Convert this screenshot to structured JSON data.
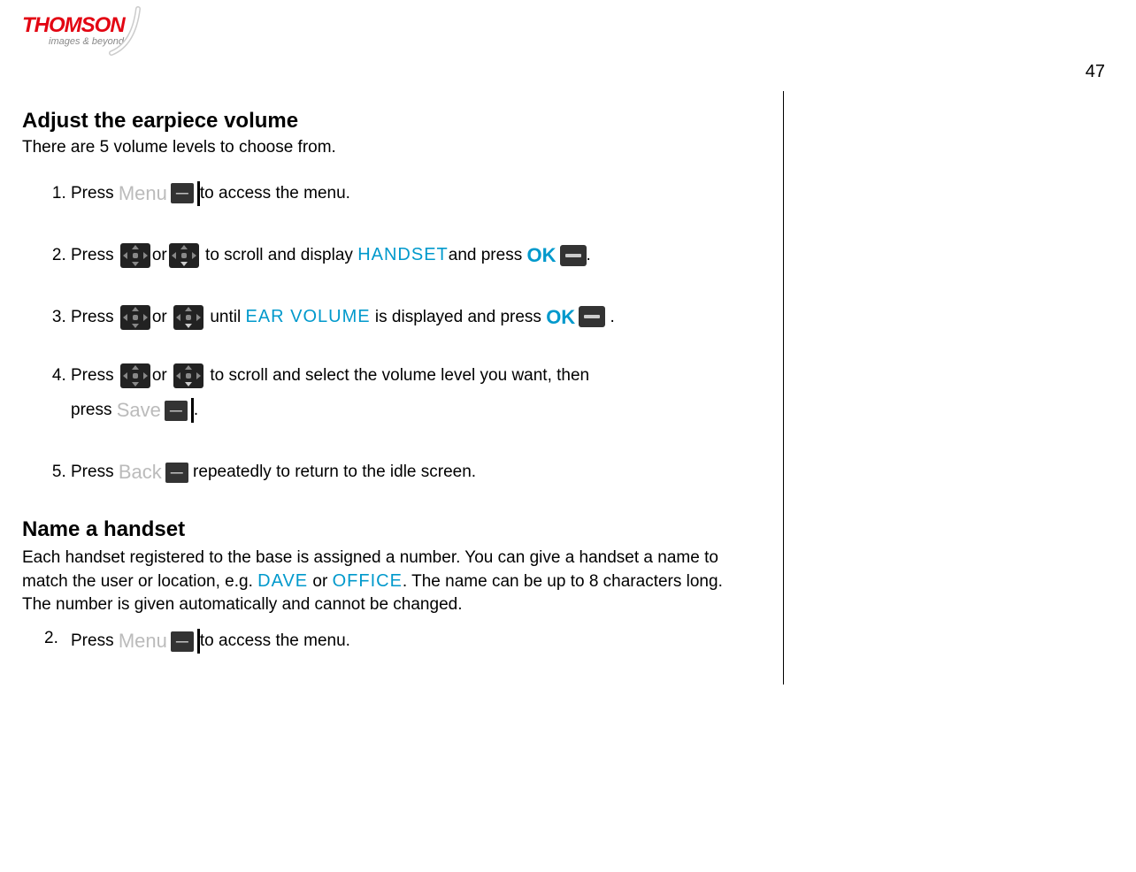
{
  "logo": {
    "brand": "THOMSON",
    "tagline": "images & beyond"
  },
  "pageNumber": "47",
  "section1": {
    "title": "Adjust the earpiece volume",
    "intro": "There are 5 volume levels to choose from.",
    "steps": {
      "s1": {
        "press": "Press",
        "menuLabel": "Menu",
        "after": "to access the menu."
      },
      "s2": {
        "press": "Press",
        "or": "or",
        "mid": " to scroll and display ",
        "kw": "HANDSET",
        "andpress": "and press ",
        "ok": "OK",
        "dot": "."
      },
      "s3": {
        "press": "Press",
        "or": "or",
        "until": " until ",
        "kw": "EAR VOLUME",
        "disp": " is displayed and press ",
        "ok": "OK",
        "dot": " ."
      },
      "s4": {
        "press": "Press",
        "or": "or",
        "mid": " to scroll and select the volume level you want, then",
        "press2": "press",
        "saveLabel": "Save",
        "dot": "."
      },
      "s5": {
        "press": "Press",
        "backLabel": "Back",
        "after": " repeatedly to return to the idle screen."
      }
    }
  },
  "section2": {
    "title": "Name a handset",
    "para_a": "Each handset registered to the base is assigned a number.  You can give a handset a name to match the user or location, e.g. ",
    "kw1": "DAVE",
    "or": " or ",
    "kw2": "OFFICE",
    "para_b": ".  The name can be up to 8 characters long.  The number is given automatically and cannot be changed.",
    "steps": {
      "s2": {
        "press": "Press",
        "menuLabel": "Menu",
        "after": "to access the menu."
      }
    }
  }
}
